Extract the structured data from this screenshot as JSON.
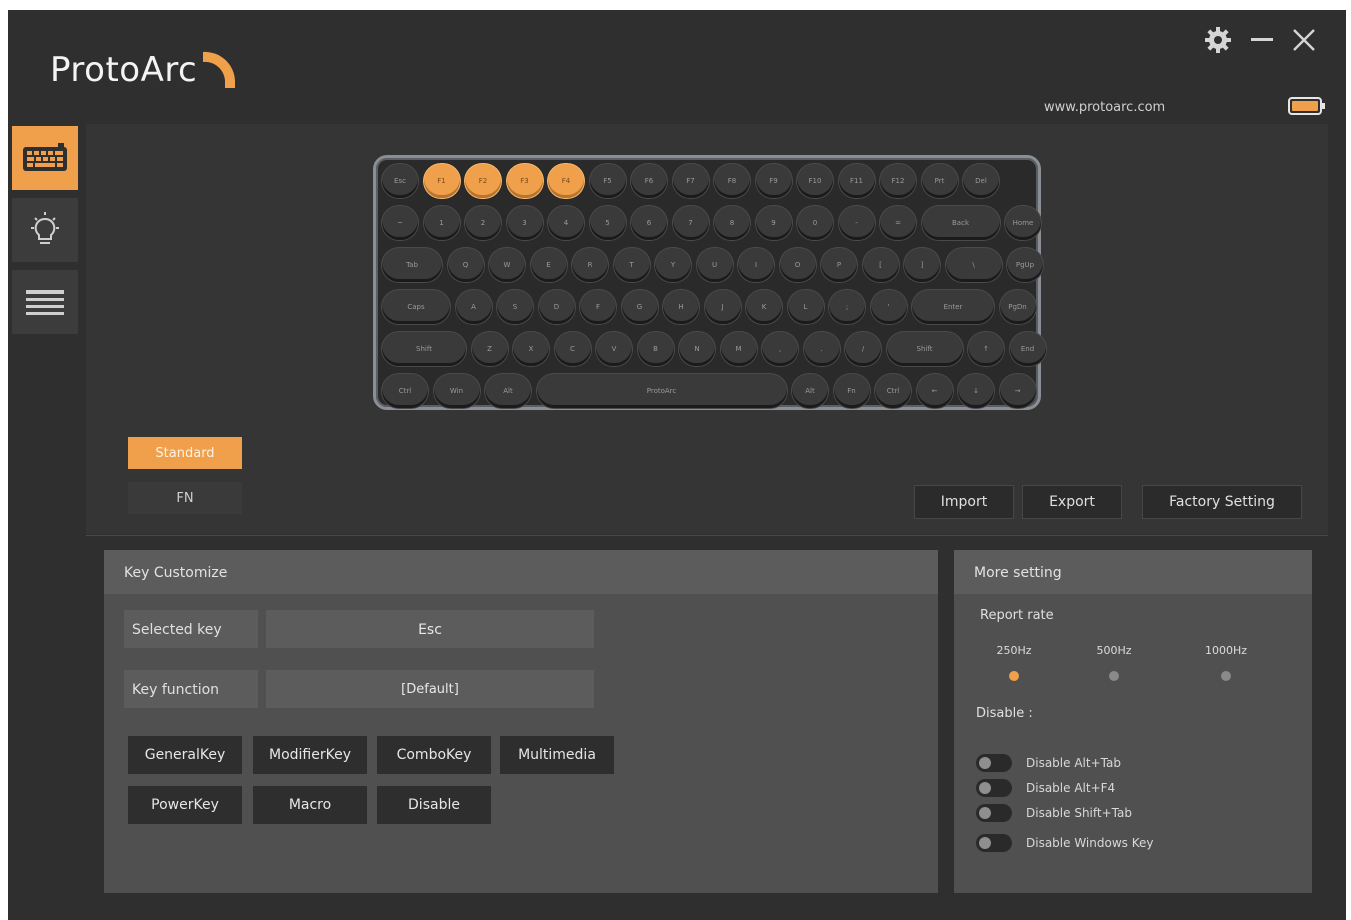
{
  "app": {
    "logo_text": "ProtoArc",
    "url": "www.protoarc.com",
    "accent": "#f0a04b",
    "window_controls": [
      "gear-icon",
      "minimize-icon",
      "close-icon"
    ]
  },
  "sidebar": {
    "items": [
      {
        "name": "keyboard-icon",
        "active": true
      },
      {
        "name": "lightbulb-icon",
        "active": false
      },
      {
        "name": "list-icon",
        "active": false
      }
    ]
  },
  "keyboard": {
    "rows": [
      [
        "Esc",
        "F1",
        "F2",
        "F3",
        "F4",
        "F5",
        "F6",
        "F7",
        "F8",
        "F9",
        "F10",
        "F11",
        "F12",
        "Prt",
        "Del"
      ],
      [
        "~",
        "1",
        "2",
        "3",
        "4",
        "5",
        "6",
        "7",
        "8",
        "9",
        "0",
        "-",
        "=",
        "Back",
        "Home"
      ],
      [
        "Tab",
        "Q",
        "W",
        "E",
        "R",
        "T",
        "Y",
        "U",
        "I",
        "O",
        "P",
        "[",
        "]",
        "\\",
        "PgUp"
      ],
      [
        "Caps",
        "A",
        "S",
        "D",
        "F",
        "G",
        "H",
        "J",
        "K",
        "L",
        ";",
        "'",
        "Enter",
        "PgDn"
      ],
      [
        "Shift",
        "Z",
        "X",
        "C",
        "V",
        "B",
        "N",
        "M",
        ",",
        ".",
        "/",
        "Shift",
        "↑",
        "End"
      ],
      [
        "Ctrl",
        "Win",
        "Alt",
        "ProtoArc",
        "Alt",
        "Fn",
        "Ctrl",
        "←",
        "↓",
        "→"
      ]
    ],
    "highlighted": [
      "F1",
      "F2",
      "F3",
      "F4"
    ]
  },
  "layers": {
    "standard_label": "Standard",
    "fn_label": "FN",
    "active": "Standard"
  },
  "actions": {
    "import_label": "Import",
    "export_label": "Export",
    "factory_label": "Factory Setting"
  },
  "key_customize": {
    "title": "Key Customize",
    "selected_key_label": "Selected key",
    "selected_key_value": "Esc",
    "key_function_label": "Key function",
    "key_function_value": "[Default]",
    "buttons": {
      "general": "GeneralKey",
      "modifier": "ModifierKey",
      "combo": "ComboKey",
      "multimedia": "Multimedia",
      "power": "PowerKey",
      "macro": "Macro",
      "disable": "Disable"
    }
  },
  "more_setting": {
    "title": "More setting",
    "report_rate_label": "Report rate",
    "rates": [
      "250Hz",
      "500Hz",
      "1000Hz"
    ],
    "selected_rate": "250Hz",
    "disable_label": "Disable :",
    "toggles": [
      "Disable Alt+Tab",
      "Disable Alt+F4",
      "Disable Shift+Tab",
      "Disable Windows Key"
    ]
  }
}
